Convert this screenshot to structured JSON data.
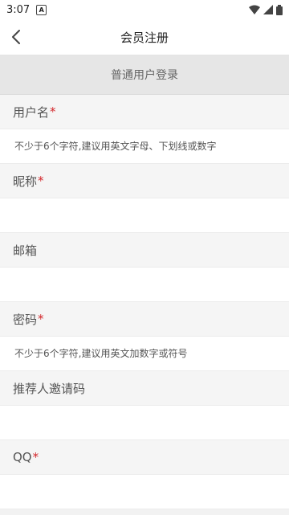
{
  "status": {
    "time": "3:07",
    "notification_badge": "A"
  },
  "header": {
    "title": "会员注册"
  },
  "tab": {
    "label": "普通用户登录"
  },
  "form": {
    "fields": [
      {
        "label": "用户名",
        "required": "*",
        "placeholder": "不少于6个字符,建议用英文字母、下划线或数字",
        "value": ""
      },
      {
        "label": "昵称",
        "required": "*",
        "placeholder": "",
        "value": ""
      },
      {
        "label": "邮箱",
        "required": "",
        "placeholder": "",
        "value": ""
      },
      {
        "label": "密码",
        "required": "*",
        "placeholder": "不少于6个字符,建议用英文加数字或符号",
        "value": ""
      },
      {
        "label": "推荐人邀请码",
        "required": "",
        "placeholder": "",
        "value": ""
      },
      {
        "label": "QQ",
        "required": "*",
        "placeholder": "",
        "value": ""
      }
    ]
  },
  "colors": {
    "required_mark": "#d3262b",
    "tab_bg": "#e6e6e6"
  },
  "icons": {
    "back": "chevron-left-icon",
    "wifi": "wifi-icon",
    "signal": "signal-icon",
    "battery": "battery-icon"
  }
}
